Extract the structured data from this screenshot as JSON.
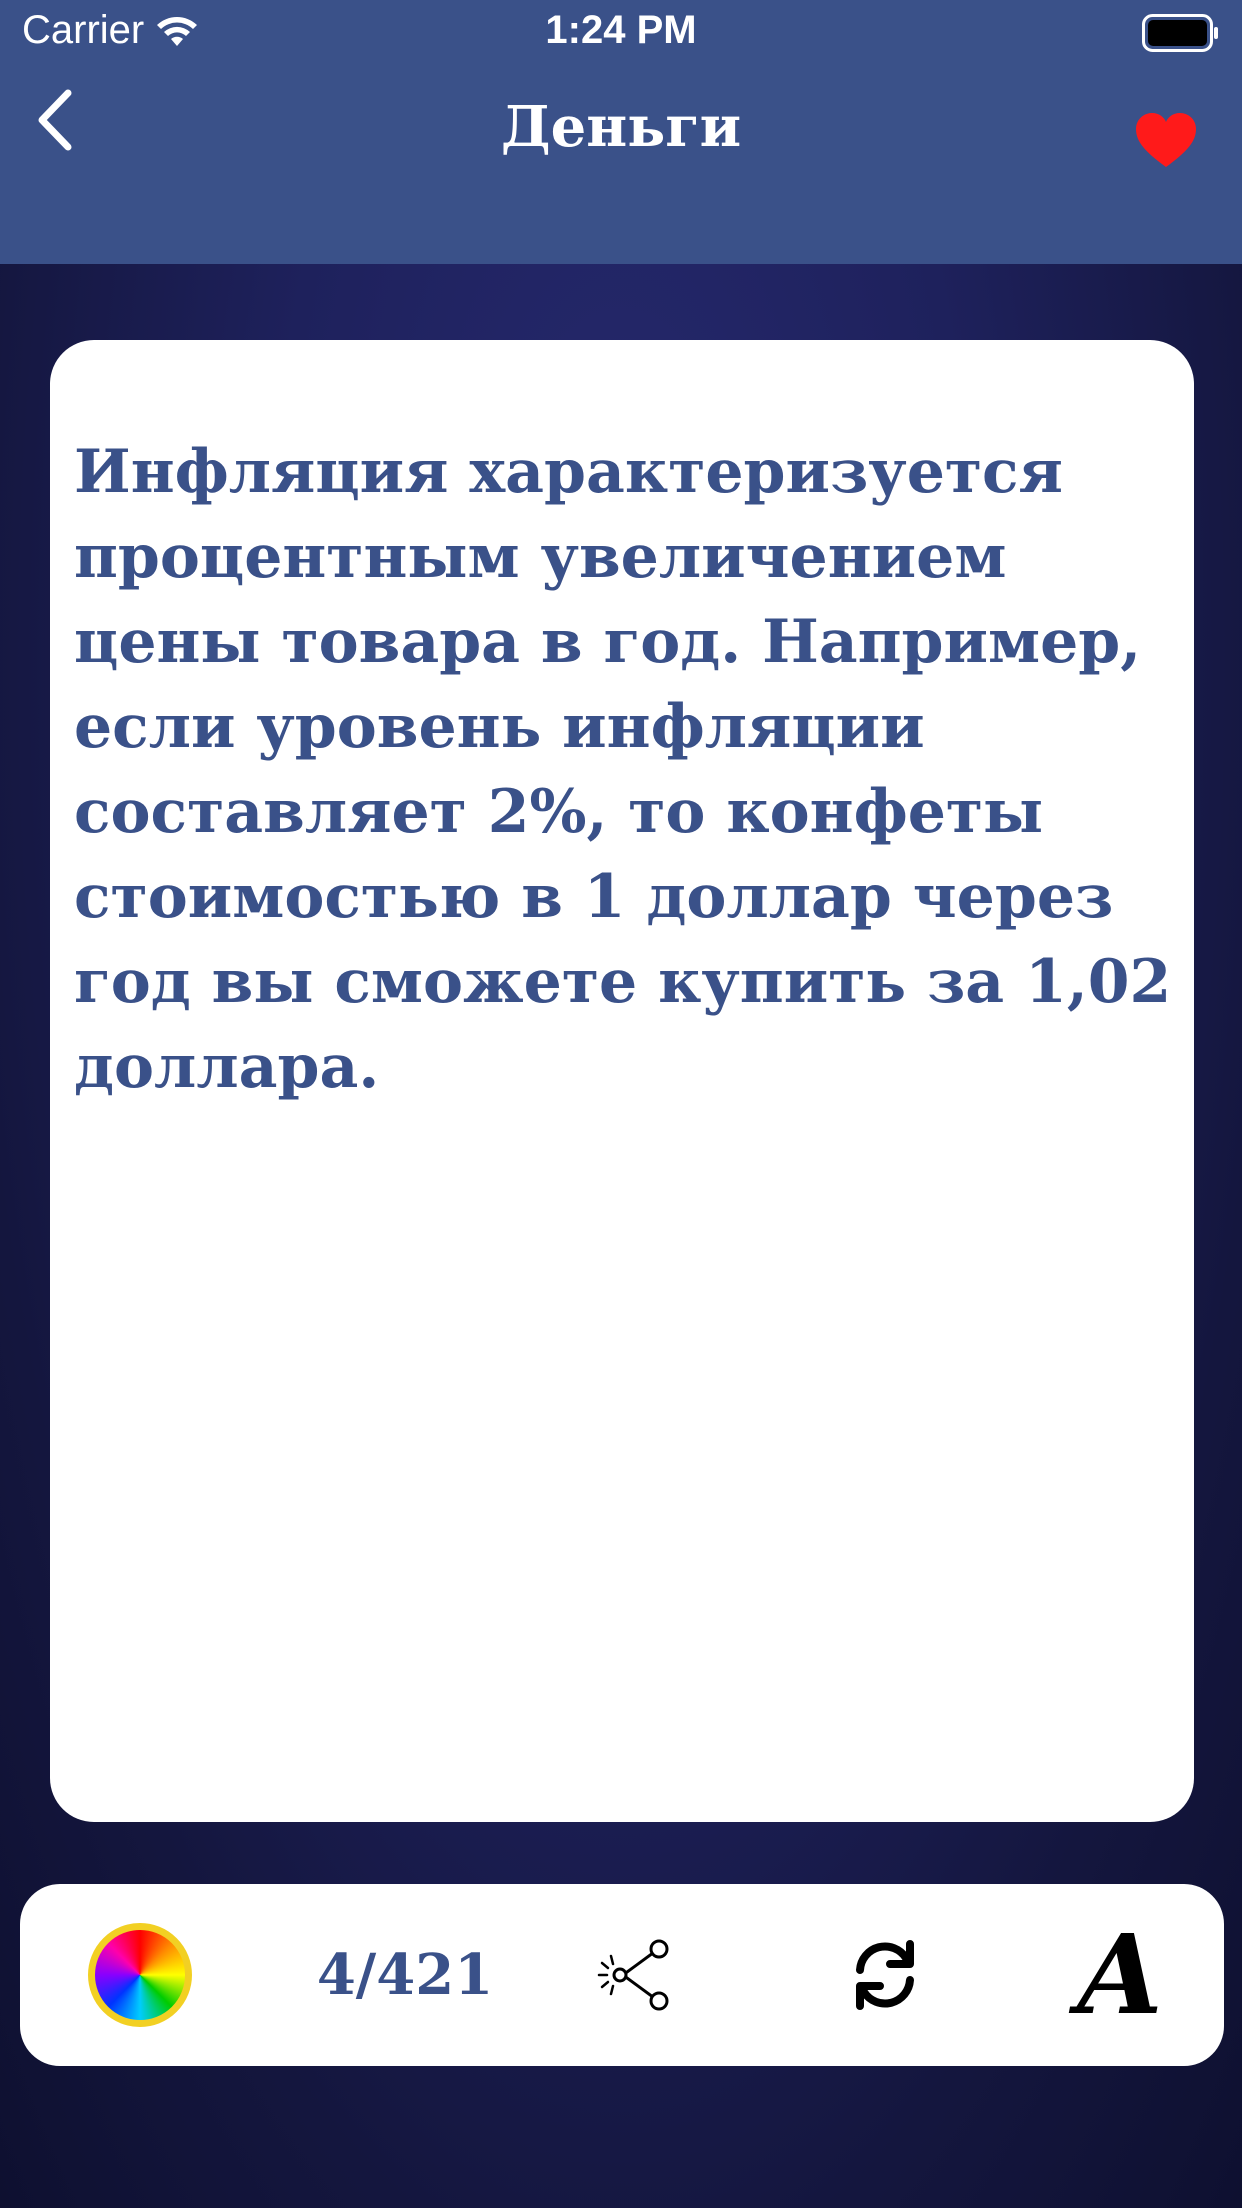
{
  "status_bar": {
    "carrier": "Carrier",
    "time": "1:24 PM"
  },
  "nav": {
    "title": "Деньги",
    "back_icon": "chevron-left-icon",
    "favorite_icon": "heart-icon",
    "favorite_color": "#ff1a1a"
  },
  "card": {
    "text": "Инфляция характеризуется процентным увеличением цены товара в год. Например, если уровень инфляции составляет 2%, то конфеты стоимостью в 1 доллар через год вы сможете купить за 1,02 доллара."
  },
  "toolbar": {
    "counter": "4/421",
    "font_glyph": "A",
    "icons": [
      "color-wheel-icon",
      "share-icon",
      "refresh-icon",
      "font-icon"
    ]
  },
  "colors": {
    "primary": "#3a5189",
    "background": "#1e215c",
    "accent_yellow": "#f2d023"
  }
}
